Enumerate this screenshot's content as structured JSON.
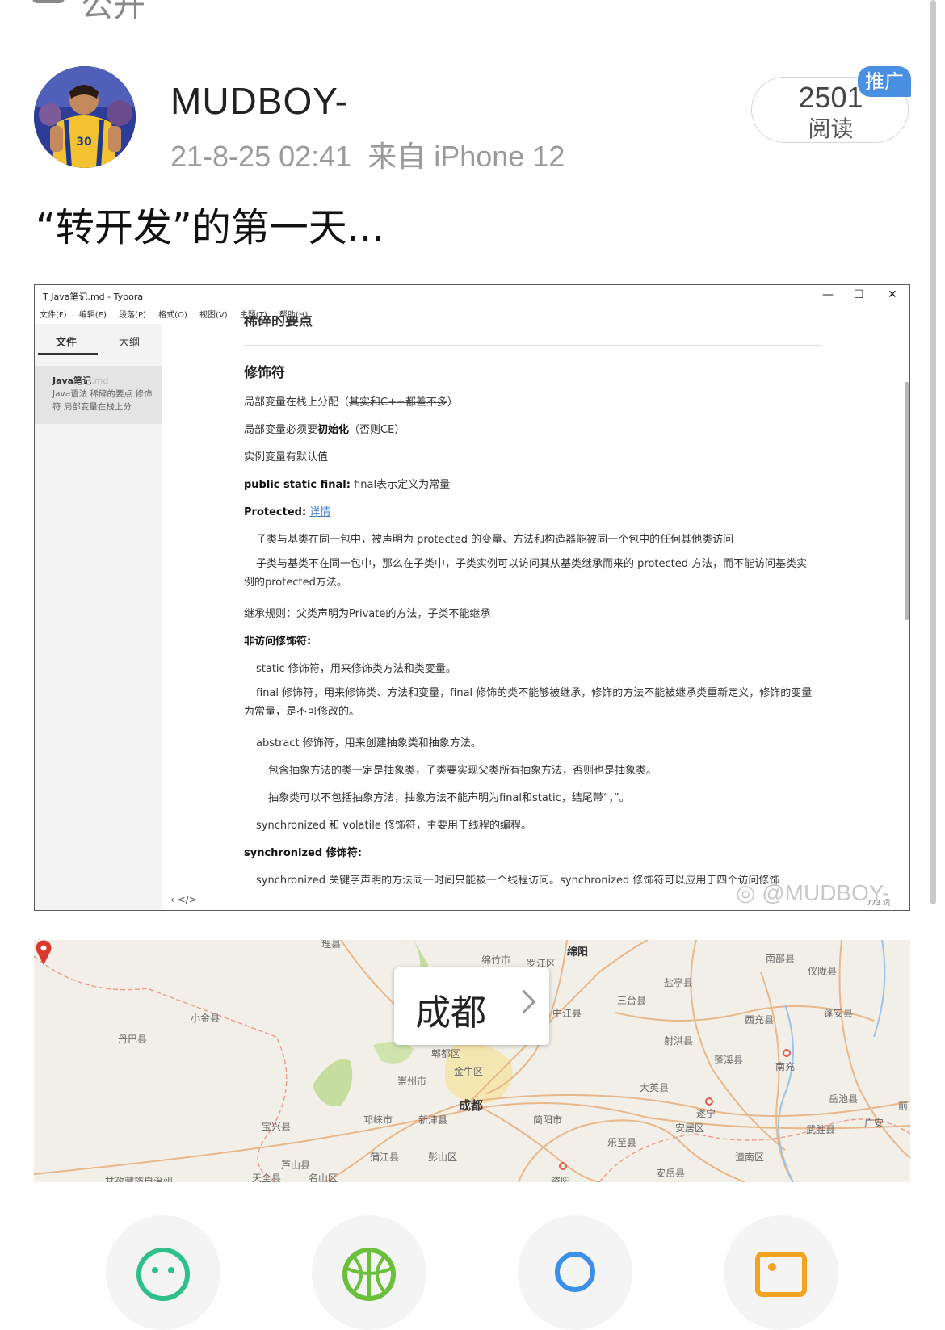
{
  "header": {
    "title_partial": "公开"
  },
  "post": {
    "username": "MUDBOY-",
    "time": "21-8-25 02:41",
    "source": "来自 iPhone 12",
    "read_count": "2501",
    "read_label": "阅读",
    "promo_badge": "推广",
    "text": "“转开发”的第一天..."
  },
  "screenshot": {
    "window_title": "Java笔记.md - Typora",
    "window_controls": [
      "—",
      "☐",
      "✕"
    ],
    "menu": [
      "文件(F)",
      "编辑(E)",
      "段落(P)",
      "格式(O)",
      "视图(V)",
      "主题(T)",
      "帮助(H)"
    ],
    "sidebar": {
      "tab_files": "文件",
      "tab_outline": "大纲",
      "file_name": "Java笔记",
      "file_ext": ".md",
      "file_desc": "Java语法 稀碎的要点 修饰符 局部变量在栈上分"
    },
    "doc": {
      "heading_cut": "稀碎的要点",
      "heading": "修饰符",
      "l1_a": "局部变量在栈上分配（",
      "l1_strike": "其实和C++都差不多",
      "l1_b": "）",
      "l2_a": "局部变量必须要",
      "l2_bold": "初始化",
      "l2_b": "（否则CE）",
      "l3": "实例变量有默认值",
      "l4_bold": "public static final:",
      "l4_b": " final表示定义为常量",
      "l5_bold": "Protected:",
      "l5_link": "详情",
      "l6": "子类与基类在同一包中，被声明为 protected 的变量、方法和构造器能被同一个包中的任何其他类访问",
      "l7": "子类与基类不在同一包中，那么在子类中，子类实例可以访问其从基类继承而来的 protected 方法，而不能访问基类实例的protected方法。",
      "l8": "继承规则：父类声明为Private的方法，子类不能继承",
      "l9_bold": "非访问修饰符:",
      "l10": "static 修饰符，用来修饰类方法和类变量。",
      "l11": "final 修饰符，用来修饰类、方法和变量，final 修饰的类不能够被继承，修饰的方法不能被继承类重新定义，修饰的变量为常量，是不可修改的。",
      "l12": "abstract 修饰符，用来创建抽象类和抽象方法。",
      "l13": "包含抽象方法的类一定是抽象类，子类要实现父类所有抽象方法，否则也是抽象类。",
      "l14": "抽象类可以不包括抽象方法，抽象方法不能声明为final和static，结尾带“；”。",
      "l15": "synchronized 和 volatile 修饰符，主要用于线程的编程。",
      "l16_bold": "synchronized 修饰符:",
      "l17": "synchronized 关键字声明的方法同一时间只能被一个线程访问。synchronized 修饰符可以应用于四个访问修饰"
    },
    "footer_nav": "‹   </>",
    "word_count": "773 词",
    "watermark": "@MUDBOY-"
  },
  "map": {
    "location": "成都",
    "labels": [
      "理县",
      "绵竹市",
      "罗江区",
      "绵阳",
      "南部县",
      "仪陇县",
      "盐亭县",
      "三台县",
      "中江县",
      "小金县",
      "丹巴县",
      "西充县",
      "蓬安县",
      "射洪县",
      "郫都区",
      "金牛区",
      "蓬溪县",
      "南充",
      "崇州市",
      "成都",
      "大英县",
      "岳池县",
      "前",
      "遂宁",
      "宝兴县",
      "邛崃市",
      "新津县",
      "简阳市",
      "安居区",
      "武胜县",
      "广安",
      "乐至县",
      "蒲江县",
      "彭山区",
      "潼南区",
      "芦山县",
      "天全县",
      "名山区",
      "甘孜藏族自治州",
      "资阳",
      "安岳县"
    ]
  },
  "share": {
    "icons": [
      "face-icon",
      "basketball-icon",
      "search-bubble-icon",
      "photo-icon"
    ]
  }
}
